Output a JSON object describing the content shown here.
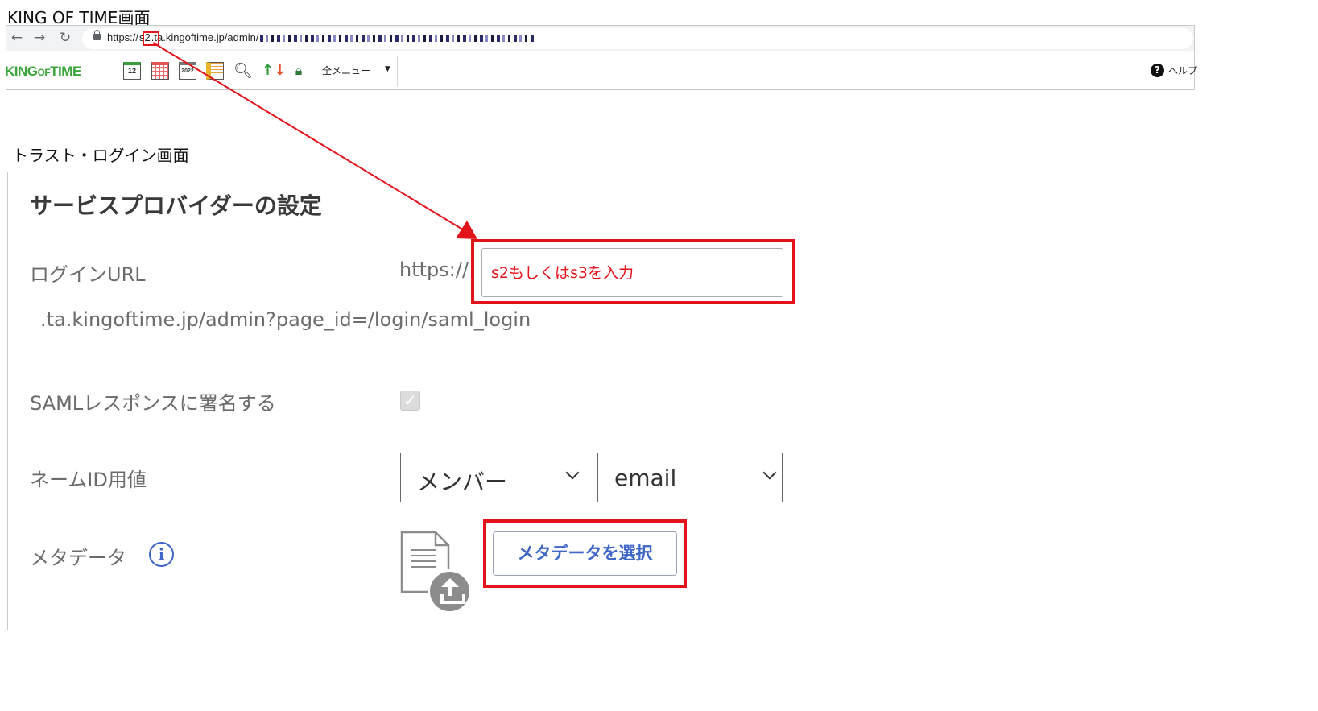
{
  "captions": {
    "top": "KING OF TIME画面",
    "trust": "トラスト・ログイン画面"
  },
  "browser": {
    "nav": {
      "back": "←",
      "forward": "→",
      "reload": "↻"
    },
    "url": {
      "protocol": "https://",
      "subdomain": "s2",
      "rest": ".ta.kingoftime.jp/admin/"
    },
    "toolbar": {
      "logo_king": "KING",
      "logo_of": "OF",
      "logo_time": "TIME",
      "cal_icon_text": "12",
      "year_icon_text": "2022",
      "all_menu": "全メニュー",
      "help": "ヘルプ"
    },
    "icons": [
      "back-arrow-icon",
      "forward-arrow-icon",
      "reload-icon",
      "lock-icon",
      "calendar-12-icon",
      "calendar-grid-icon",
      "calendar-2022-icon",
      "sheet-icon",
      "search-person-icon",
      "transfer-arrows-icon",
      "lock-settings-icon",
      "chevron-down-icon",
      "help-icon"
    ]
  },
  "panel": {
    "title": "サービスプロバイダーの設定",
    "login_url": {
      "label": "ログインURL",
      "prefix": "https://",
      "input_value": "s2もしくはs3を入力",
      "suffix": ".ta.kingoftime.jp/admin?page_id=/login/saml_login"
    },
    "saml": {
      "label": "SAMLレスポンスに署名する",
      "checked": true
    },
    "name_id": {
      "label": "ネームID用値",
      "select1": "メンバー",
      "select2": "email"
    },
    "metadata": {
      "label": "メタデータ",
      "info_icon": "i",
      "button": "メタデータを選択"
    }
  },
  "annotation_color": "#e3131c",
  "accent_color": "#3f67c8"
}
